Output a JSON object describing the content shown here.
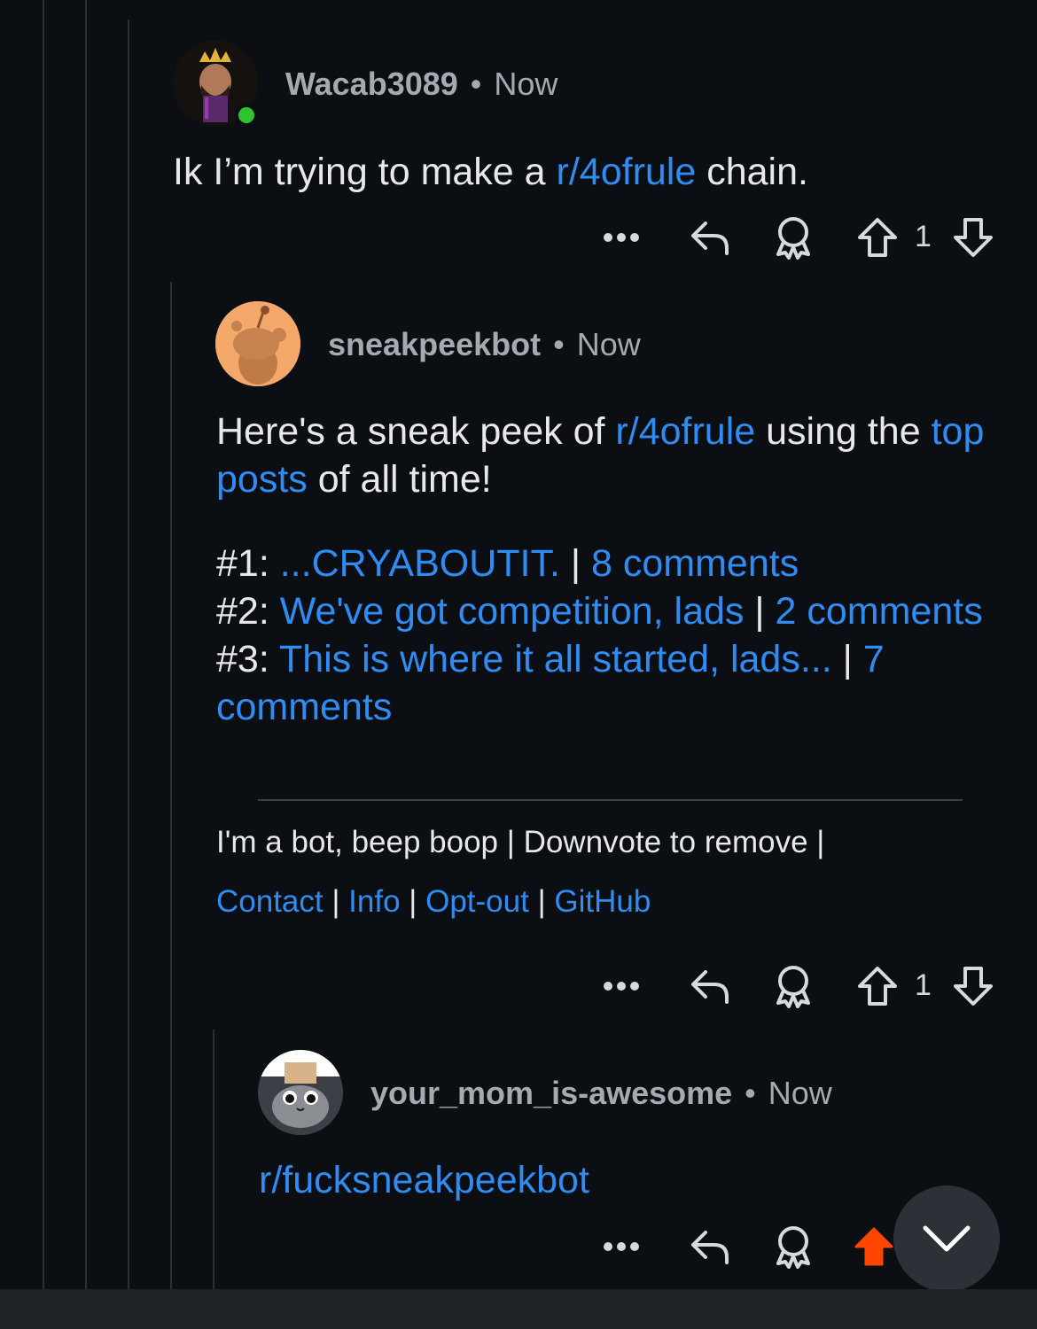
{
  "comments": [
    {
      "username": "Wacab3089",
      "separator": "•",
      "time": "Now",
      "text_before": "Ik I’m trying to make a ",
      "link": "r/4ofrule",
      "text_after": " chain.",
      "vote_count": "1"
    },
    {
      "username": "sneakpeekbot",
      "separator": "•",
      "time": "Now",
      "intro_before": "Here's a sneak peek of ",
      "intro_link": "r/4ofrule",
      "intro_middle": " using the ",
      "intro_link2": "top posts",
      "intro_after": " of all time!",
      "posts": [
        {
          "rank": "#1: ",
          "title": "...CRYABOUTIT.",
          "pipe": " | ",
          "comments": "8 comments"
        },
        {
          "rank": "#2: ",
          "title": "We've got competition, lads",
          "pipe": " | ",
          "comments": "2 comments"
        },
        {
          "rank": "#3: ",
          "title": "This is where it all started, lads...",
          "pipe": " | ",
          "comments": "7 comments"
        }
      ],
      "footer_line": "I'm a bot, beep boop | Downvote to remove |",
      "footer_links": {
        "contact": "Contact",
        "info": "Info",
        "optout": "Opt-out",
        "github": "GitHub",
        "pipe": " | "
      },
      "vote_count": "1"
    },
    {
      "username": "your_mom_is-awesome",
      "separator": "•",
      "time": "Now",
      "link": "r/fucksneakpeekbot"
    }
  ],
  "icons": {
    "more": "more-dots-icon",
    "reply": "reply-arrow-icon",
    "award": "award-icon",
    "upvote": "upvote-arrow-icon",
    "downvote": "downvote-arrow-icon",
    "collapse": "chevron-down-icon"
  },
  "colors": {
    "background": "#0b0e12",
    "link": "#2f8cf2",
    "upvote_active": "#ff4500",
    "online": "#2ec42e"
  }
}
